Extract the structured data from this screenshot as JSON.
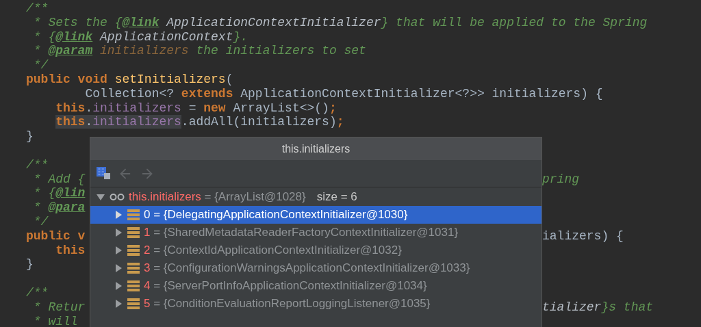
{
  "code": {
    "lines": [
      {
        "kind": "code",
        "tokens": [
          {
            "kind": "comment",
            "text": "/**"
          }
        ]
      },
      {
        "kind": "code",
        "tokens": [
          {
            "kind": "comment",
            "text": " * Sets the {"
          },
          {
            "kind": "tag",
            "text": "@link"
          },
          {
            "kind": "ref",
            "text": " ApplicationContextInitializer"
          },
          {
            "kind": "comment",
            "text": "} that will be applied to the Spring"
          }
        ]
      },
      {
        "kind": "code",
        "tokens": [
          {
            "kind": "comment",
            "text": " * {"
          },
          {
            "kind": "tag",
            "text": "@link"
          },
          {
            "kind": "ref",
            "text": " ApplicationContext"
          },
          {
            "kind": "comment",
            "text": "}."
          }
        ]
      },
      {
        "kind": "code",
        "tokens": [
          {
            "kind": "comment",
            "text": " * "
          },
          {
            "kind": "tag",
            "text": "@param"
          },
          {
            "kind": "param",
            "text": " initializers"
          },
          {
            "kind": "comment",
            "text": " the initializers to set"
          }
        ]
      },
      {
        "kind": "code",
        "tokens": [
          {
            "kind": "comment",
            "text": " */"
          }
        ]
      },
      {
        "kind": "code",
        "tokens": [
          {
            "kind": "keyword",
            "text": "public void "
          },
          {
            "kind": "method",
            "text": "setInitializers"
          },
          {
            "kind": "plain",
            "text": "("
          }
        ]
      },
      {
        "kind": "code",
        "tokens": [
          {
            "kind": "plain",
            "text": "        Collection<? "
          },
          {
            "kind": "keyword",
            "text": "extends"
          },
          {
            "kind": "plain",
            "text": " ApplicationContextInitializer<?>> initializers) {"
          }
        ]
      },
      {
        "kind": "block",
        "tokens": [
          {
            "kind": "keyword",
            "text": "this"
          },
          {
            "kind": "plain",
            "text": "."
          },
          {
            "kind": "field",
            "text": "initializers"
          },
          {
            "kind": "plain",
            "text": " = "
          },
          {
            "kind": "keyword",
            "text": "new "
          },
          {
            "kind": "plain",
            "text": "ArrayList<>()"
          },
          {
            "kind": "keyword",
            "text": ";"
          }
        ]
      },
      {
        "kind": "block",
        "tokens": [
          {
            "kind": "keyword",
            "text": "this",
            "highlighted": true
          },
          {
            "kind": "plain",
            "text": ".",
            "highlighted": true
          },
          {
            "kind": "field",
            "text": "initializers",
            "highlighted": true
          },
          {
            "kind": "plain",
            "text": ".addAll(initializers)"
          },
          {
            "kind": "keyword",
            "text": ";"
          }
        ]
      },
      {
        "kind": "code",
        "tokens": [
          {
            "kind": "plain",
            "text": "}"
          }
        ]
      },
      {
        "kind": "blank"
      },
      {
        "kind": "code",
        "tokens": [
          {
            "kind": "comment",
            "text": "/**"
          }
        ]
      },
      {
        "kind": "code",
        "tokens": [
          {
            "kind": "comment",
            "text": " * Add {"
          }
        ],
        "right": [
          {
            "kind": "comment",
            "text": "pring"
          }
        ]
      },
      {
        "kind": "code",
        "tokens": [
          {
            "kind": "comment",
            "text": " * {"
          },
          {
            "kind": "tag",
            "text": "@lin"
          }
        ]
      },
      {
        "kind": "code",
        "tokens": [
          {
            "kind": "comment",
            "text": " * "
          },
          {
            "kind": "tag",
            "text": "@para"
          }
        ]
      },
      {
        "kind": "code",
        "tokens": [
          {
            "kind": "comment",
            "text": " */"
          }
        ]
      },
      {
        "kind": "code",
        "tokens": [
          {
            "kind": "keyword",
            "text": "public v"
          }
        ],
        "right": [
          {
            "kind": "plain",
            "text": "ializers) {"
          }
        ]
      },
      {
        "kind": "block",
        "tokens": [
          {
            "kind": "keyword",
            "text": "this"
          }
        ]
      },
      {
        "kind": "code",
        "tokens": [
          {
            "kind": "plain",
            "text": "}"
          }
        ]
      },
      {
        "kind": "blank"
      },
      {
        "kind": "code",
        "tokens": [
          {
            "kind": "comment",
            "text": "/**"
          }
        ]
      },
      {
        "kind": "code",
        "tokens": [
          {
            "kind": "comment",
            "text": " * Retur"
          }
        ],
        "right": [
          {
            "kind": "ref",
            "text": "tializer"
          },
          {
            "kind": "comment",
            "text": "}s that"
          }
        ]
      },
      {
        "kind": "code",
        "tokens": [
          {
            "kind": "comment",
            "text": " * will"
          }
        ]
      }
    ]
  },
  "popup": {
    "title": "this.initializers",
    "toolbar": [
      {
        "kind": "view",
        "disabled": false
      },
      {
        "kind": "back",
        "disabled": true
      },
      {
        "kind": "forward",
        "disabled": true
      }
    ],
    "tree": {
      "name": "this.initializers",
      "value": " = {ArrayList@1028}",
      "size": "size = 6",
      "expanded": true,
      "children": [
        {
          "index": "0",
          "value": " = {DelegatingApplicationContextInitializer@1030}",
          "selected": true,
          "expanded": false
        },
        {
          "index": "1",
          "value": " = {SharedMetadataReaderFactoryContextInitializer@1031}",
          "selected": false,
          "expanded": false
        },
        {
          "index": "2",
          "value": " = {ContextIdApplicationContextInitializer@1032}",
          "selected": false,
          "expanded": false
        },
        {
          "index": "3",
          "value": " = {ConfigurationWarningsApplicationContextInitializer@1033}",
          "selected": false,
          "expanded": false
        },
        {
          "index": "4",
          "value": " = {ServerPortInfoApplicationContextInitializer@1034}",
          "selected": false,
          "expanded": false
        },
        {
          "index": "5",
          "value": " = {ConditionEvaluationReportLoggingListener@1035}",
          "selected": false,
          "expanded": false
        }
      ]
    }
  }
}
